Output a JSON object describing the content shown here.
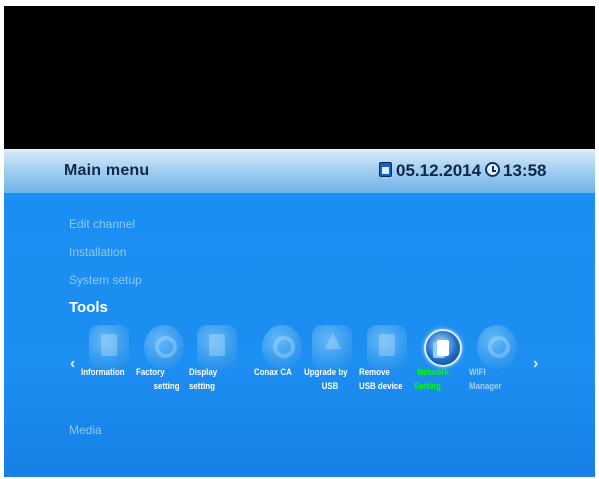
{
  "header": {
    "title": "Main menu",
    "date": "05.12.2014",
    "time": "13:58",
    "date_icon": "calendar-icon",
    "time_icon": "clock-icon"
  },
  "menu": {
    "items": [
      {
        "label": "Edit channel"
      },
      {
        "label": "Installation"
      },
      {
        "label": "System setup"
      },
      {
        "label": "Tools",
        "selected": true
      },
      {
        "label": "Media"
      }
    ]
  },
  "tools": {
    "prev_arrow": "‹",
    "next_arrow": "›",
    "items": [
      {
        "line1": "Information",
        "line2": "",
        "icon": "information-icon"
      },
      {
        "line1": "Factory",
        "line2": "setting",
        "icon": "factory-reset-icon"
      },
      {
        "line1": "Display",
        "line2": "setting",
        "icon": "display-icon"
      },
      {
        "line1": "Conax CA",
        "line2": "",
        "icon": "conax-icon"
      },
      {
        "line1": "Upgrade by",
        "line2": "USB",
        "icon": "usb-upgrade-icon"
      },
      {
        "line1": "Remove",
        "line2": "USB device",
        "icon": "usb-remove-icon"
      },
      {
        "line1": "Network",
        "line2": "Setting",
        "icon": "network-icon",
        "selected": true
      },
      {
        "line1": "WIFI",
        "line2": "Manager",
        "icon": "wifi-icon"
      }
    ]
  },
  "colors": {
    "background": "#1a8ff3",
    "header": "#a9d3f2",
    "selected_label": "#00ff00",
    "selected_menu": "#ffffff",
    "menu_text": "#8ec9f7"
  }
}
